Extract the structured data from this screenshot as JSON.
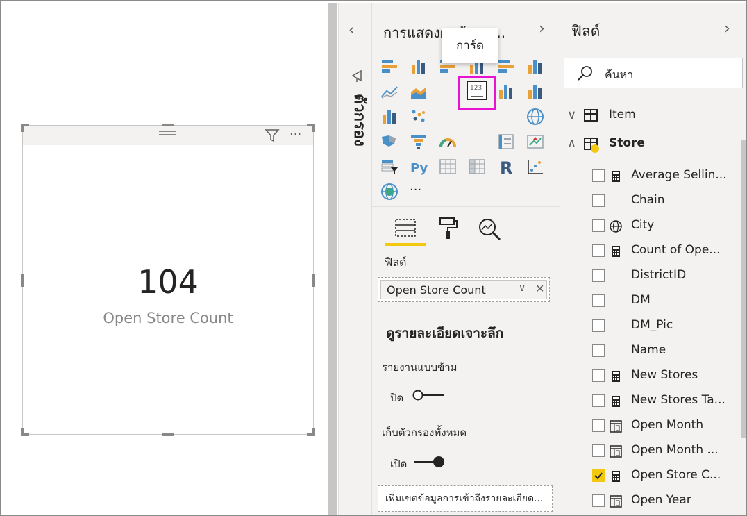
{
  "card": {
    "value": "104",
    "label": "Open Store Count"
  },
  "filters_pane": {
    "label": "ตัวกรอง"
  },
  "visualizations_pane": {
    "title": "การแสดงผลข้อมูล...",
    "tooltip": "การ์ด",
    "more_label": "···",
    "fields_label": "ฟิลด์",
    "field_value": "Open Store Count",
    "drillthrough_title": "ดูรายละเอียดเจาะลึก",
    "cross_report_label": "รายงานแบบข้าม",
    "cross_report_toggle": "ปิด",
    "keep_filters_label": "เก็บตัวกรองทั้งหมด",
    "keep_filters_toggle": "เปิด",
    "drillthrough_well": "เพิ่มเขตข้อมูลการเข้าถึงรายละเอียด..."
  },
  "fields_pane": {
    "title": "ฟิลด์",
    "search_placeholder": "ค้นหา",
    "tables": [
      {
        "name": "Item",
        "expanded": false
      },
      {
        "name": "Store",
        "expanded": true
      }
    ],
    "store_fields": [
      {
        "name": "Average Sellin...",
        "icon": "calculator-icon",
        "checked": false
      },
      {
        "name": "Chain",
        "icon": "",
        "checked": false
      },
      {
        "name": "City",
        "icon": "globe-icon",
        "checked": false
      },
      {
        "name": "Count of Ope...",
        "icon": "calculator-icon",
        "checked": false
      },
      {
        "name": "DistrictID",
        "icon": "",
        "checked": false
      },
      {
        "name": "DM",
        "icon": "",
        "checked": false
      },
      {
        "name": "DM_Pic",
        "icon": "",
        "checked": false
      },
      {
        "name": "Name",
        "icon": "",
        "checked": false
      },
      {
        "name": "New Stores",
        "icon": "calculator-icon",
        "checked": false
      },
      {
        "name": "New Stores Ta...",
        "icon": "calculator-icon",
        "checked": false
      },
      {
        "name": "Open Month",
        "icon": "date-hierarchy-icon",
        "checked": false
      },
      {
        "name": "Open Month ...",
        "icon": "date-hierarchy-icon",
        "checked": false
      },
      {
        "name": "Open Store C...",
        "icon": "calculator-icon",
        "checked": true
      },
      {
        "name": "Open Year",
        "icon": "date-hierarchy-icon",
        "checked": false
      }
    ]
  },
  "colors": {
    "accent_yellow": "#f2c811",
    "selection_magenta": "#e614d2",
    "viz_blue": "#4a90c8",
    "viz_orange": "#e8a13a",
    "pane_bg": "#f3f2f1"
  }
}
